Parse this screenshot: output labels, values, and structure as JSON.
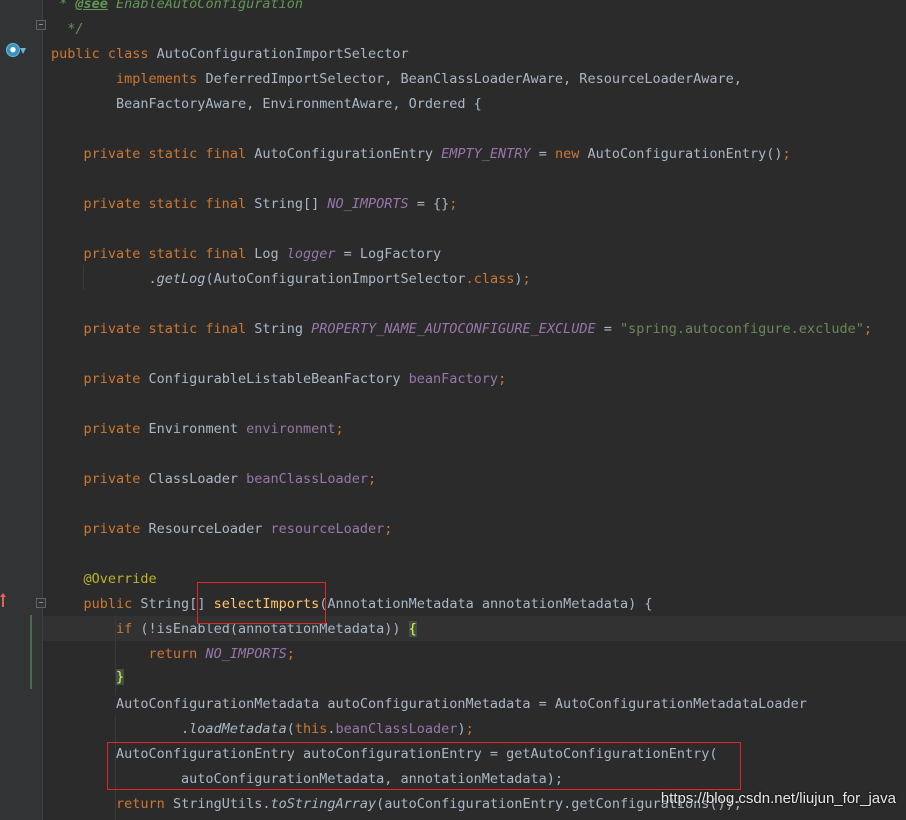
{
  "code": {
    "comment_see_tag": "@see",
    "comment_see_text": " EnableAutoConfiguration",
    "comment_end": "*/",
    "class_name": "AutoConfigurationImportSelector",
    "implements_line": "DeferredImportSelector, BeanClassLoaderAware, ResourceLoaderAware,",
    "implements_line2": "BeanFactoryAware, EnvironmentAware, Ordered {",
    "empty_entry_type": "AutoConfigurationEntry",
    "empty_entry_name": "EMPTY_ENTRY",
    "empty_entry_ctor": "AutoConfigurationEntry()",
    "no_imports_type": "String[]",
    "no_imports_name": "NO_IMPORTS",
    "logger_type": "Log",
    "logger_name": "logger",
    "logger_factory": "LogFactory",
    "get_log": "getLog",
    "get_log_arg": "AutoConfigurationImportSelector",
    "prop_type": "String",
    "prop_name": "PROPERTY_NAME_AUTOCONFIGURE_EXCLUDE",
    "prop_value": "\"spring.autoconfigure.exclude\"",
    "bean_factory_type": "ConfigurableListableBeanFactory",
    "bean_factory_name": "beanFactory",
    "env_type": "Environment",
    "env_name": "environment",
    "bcl_type": "ClassLoader",
    "bcl_name": "beanClassLoader",
    "rl_type": "ResourceLoader",
    "rl_name": "resourceLoader",
    "override": "@Override",
    "method_return": "String[]",
    "method_name": "selectImports",
    "method_params": "AnnotationMetadata annotationMetadata) {",
    "if_cond": "(!isEnabled(annotationMetadata)) ",
    "brace_open": "{",
    "return_no_imports": "NO_IMPORTS",
    "brace_close": "}",
    "acm_line": "AutoConfigurationMetadata autoConfigurationMetadata = AutoConfigurationMetadataLoader",
    "load_metadata": "loadMetadata",
    "bcl_ref": "beanClassLoader",
    "ace_line": "AutoConfigurationEntry autoConfigurationEntry = getAutoConfigurationEntry(",
    "ace_args": "autoConfigurationMetadata, annotationMetadata);",
    "return_line_a": "StringUtils.",
    "to_string_array": "toStringArray",
    "return_line_b": "(autoConfigurationEntry.getConfigurations());"
  },
  "watermark": "https://blog.csdn.net/liujun_for_java",
  "icons": {
    "implemented": "implemented-icon",
    "override": "override-arrow-icon",
    "fold": "fold-icon"
  }
}
